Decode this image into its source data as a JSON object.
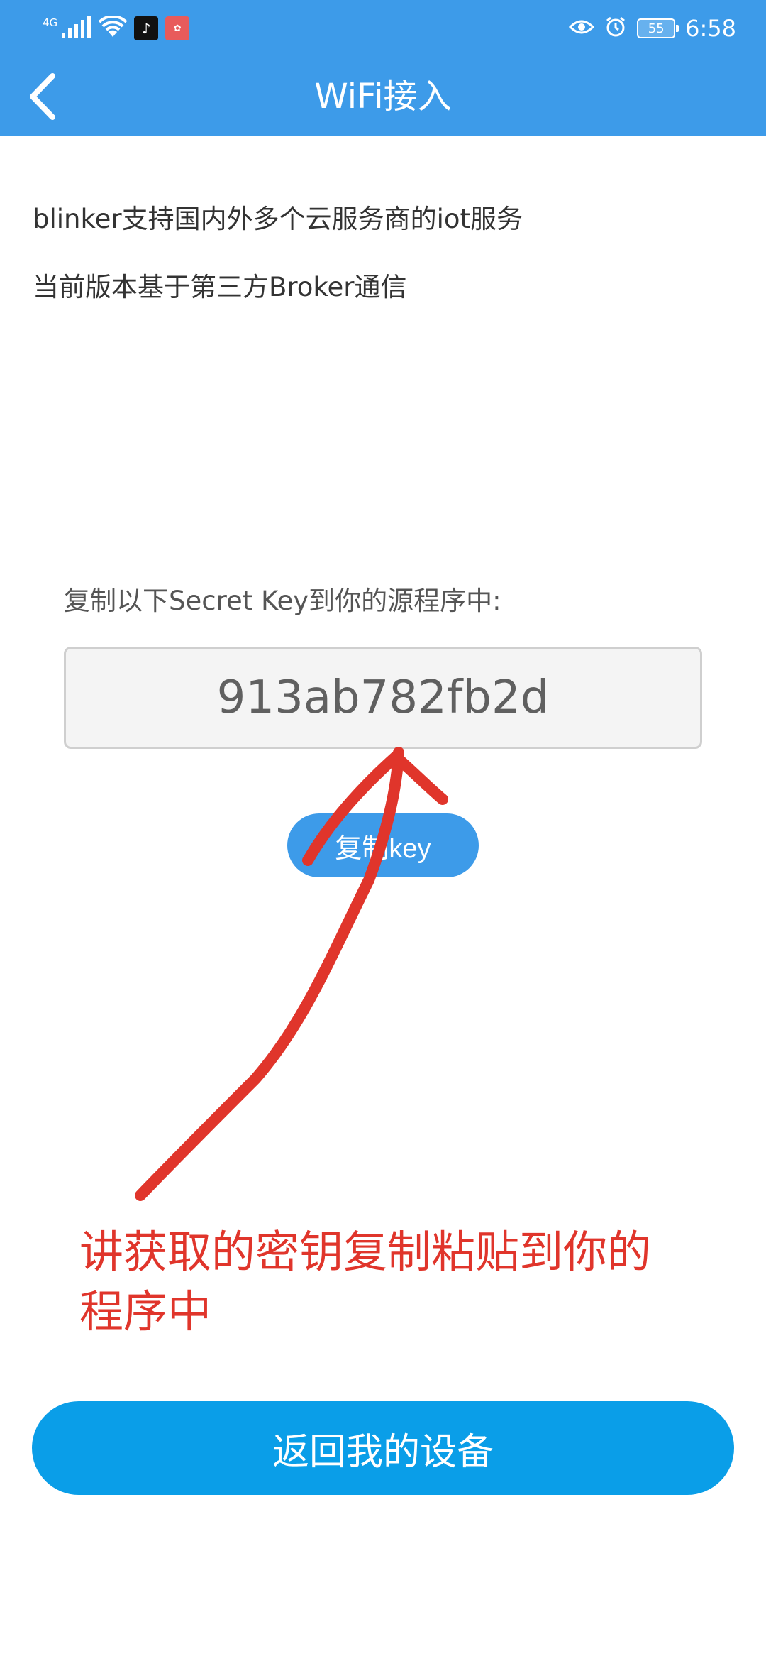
{
  "status_bar": {
    "network": "4G",
    "time": "6:58",
    "battery": "55"
  },
  "header": {
    "title": "WiFi接入"
  },
  "info": {
    "line1": "blinker支持国内外多个云服务商的iot服务",
    "line2": "当前版本基于第三方Broker通信"
  },
  "key_section": {
    "label": "复制以下Secret Key到你的源程序中:",
    "key_value": "913ab782fb2d",
    "copy_button": "复制key"
  },
  "annotation": {
    "text": "讲获取的密钥复制粘贴到你的程序中",
    "color": "#e0352b"
  },
  "footer": {
    "return_button": "返回我的设备"
  },
  "colors": {
    "primary": "#3d9be9",
    "return_button": "#0a9ee8"
  }
}
